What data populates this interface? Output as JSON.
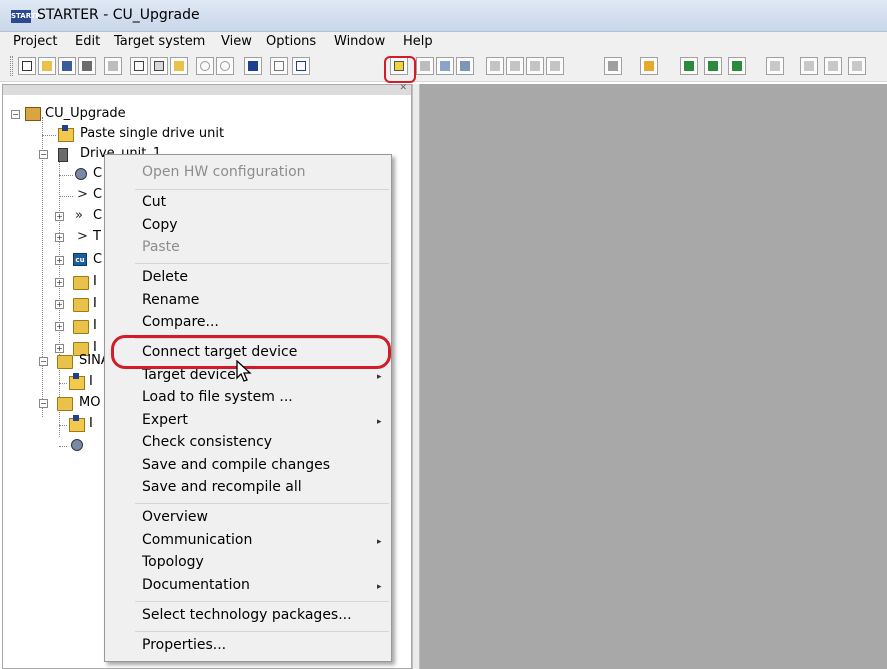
{
  "window": {
    "app_icon": "STARTER",
    "title": "STARTER - CU_Upgrade"
  },
  "menu": [
    "Project",
    "Edit",
    "Target system",
    "View",
    "Options",
    "Window",
    "Help"
  ],
  "toolbar": {
    "highlight_color": "#d21c2a",
    "icons": [
      "new-icon",
      "open-icon",
      "save-icon",
      "save-compile-icon",
      "print-icon",
      "cut-icon",
      "copy-icon",
      "paste-icon",
      "undo-icon",
      "redo-icon",
      "help-pointer-icon",
      "x1-icon",
      "x2-icon",
      "connect-target-icon",
      "load-icon",
      "download-icon",
      "upload-icon",
      "fixed-icon",
      "load-cpu-icon",
      "load-system-icon",
      "target-device-icon",
      "counter-icon",
      "accessible-nodes-icon",
      "trace-icon",
      "monitor-icon",
      "control-panel-icon",
      "topology-icon",
      "toolbox-icon",
      "more-icon"
    ]
  },
  "tree": {
    "root": "CU_Upgrade",
    "items": [
      {
        "label": "Paste single drive unit",
        "icon": "paste-icon"
      },
      {
        "label": "Drive_unit_1",
        "icon": "drive-icon"
      },
      {
        "label": "C",
        "icon": "gear-icon"
      },
      {
        "label": "C",
        "icon": "arrow-icon"
      },
      {
        "label": "C",
        "icon": "double-arrow-icon"
      },
      {
        "label": "T",
        "icon": "arrow-icon"
      },
      {
        "label": "C",
        "icon": "cu-icon"
      },
      {
        "label": "I",
        "icon": "folder-icon"
      },
      {
        "label": "I",
        "icon": "folder-icon"
      },
      {
        "label": "I",
        "icon": "folder-icon"
      },
      {
        "label": "I",
        "icon": "folder-icon"
      },
      {
        "label": "SINA",
        "icon": "folder-icon"
      },
      {
        "label": "I",
        "icon": "paste-icon"
      },
      {
        "label": "MO",
        "icon": "folder-icon"
      },
      {
        "label": "I",
        "icon": "paste-icon"
      },
      {
        "label": "",
        "icon": "gear-icon"
      }
    ]
  },
  "context_menu": {
    "items": [
      {
        "label": "Open HW configuration",
        "enabled": false
      },
      {
        "label": "Cut",
        "enabled": true
      },
      {
        "label": "Copy",
        "enabled": true
      },
      {
        "label": "Paste",
        "enabled": false
      },
      {
        "label": "Delete",
        "enabled": true
      },
      {
        "label": "Rename",
        "enabled": true
      },
      {
        "label": "Compare...",
        "enabled": true
      },
      {
        "label": "Connect target device",
        "enabled": true,
        "highlighted": true
      },
      {
        "label": "Target device",
        "enabled": true,
        "submenu": true
      },
      {
        "label": "Load to file system ...",
        "enabled": true
      },
      {
        "label": "Expert",
        "enabled": true,
        "submenu": true
      },
      {
        "label": "Check consistency",
        "enabled": true
      },
      {
        "label": "Save and compile changes",
        "enabled": true
      },
      {
        "label": "Save and recompile all",
        "enabled": true
      },
      {
        "label": "Overview",
        "enabled": true
      },
      {
        "label": "Communication",
        "enabled": true,
        "submenu": true
      },
      {
        "label": "Topology",
        "enabled": true
      },
      {
        "label": "Documentation",
        "enabled": true,
        "submenu": true
      },
      {
        "label": "Select technology packages...",
        "enabled": true
      },
      {
        "label": "Properties...",
        "enabled": true
      }
    ],
    "submenu_arrow": "▸"
  },
  "colors": {
    "workspace": "#a8a8a8",
    "menu_background": "#f0f0f0",
    "highlight": "#d21c2a"
  }
}
